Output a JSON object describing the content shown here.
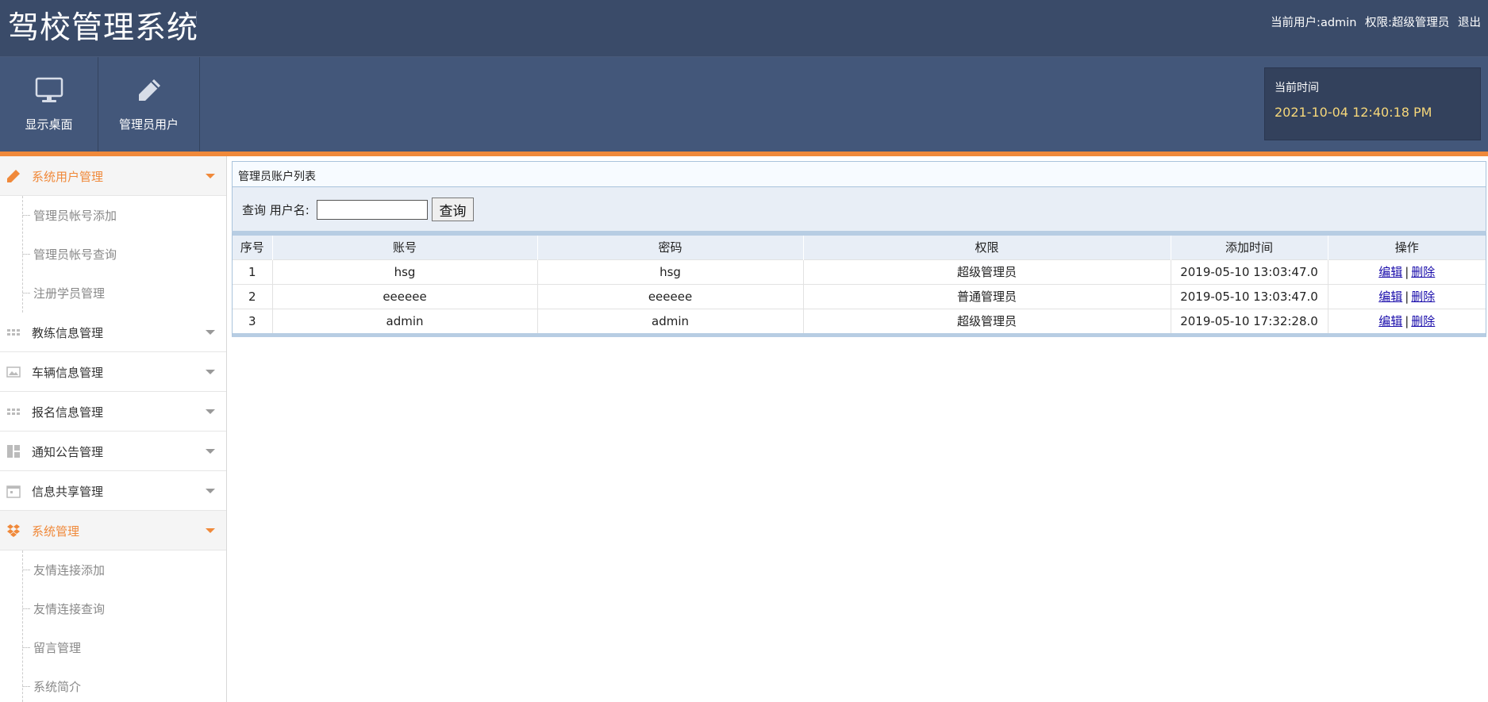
{
  "header": {
    "app_title": "驾校管理系统",
    "current_user_label": "当前用户:",
    "current_user": "admin",
    "role_label": "权限:",
    "role": "超级管理员",
    "logout": "退出"
  },
  "toolbar": {
    "items": [
      {
        "label": "显示桌面",
        "icon": "monitor-icon"
      },
      {
        "label": "管理员用户",
        "icon": "pencil-icon"
      }
    ],
    "time_label": "当前时间",
    "time_value": "2021-10-04 12:40:18 PM"
  },
  "sidebar": {
    "groups": [
      {
        "label": "系统用户管理",
        "icon": "pencil-icon",
        "active": true,
        "items": [
          "管理员帐号添加",
          "管理员帐号查询",
          "注册学员管理"
        ]
      },
      {
        "label": "教练信息管理",
        "icon": "grid-icon",
        "active": false
      },
      {
        "label": "车辆信息管理",
        "icon": "image-icon",
        "active": false
      },
      {
        "label": "报名信息管理",
        "icon": "grid-icon",
        "active": false
      },
      {
        "label": "通知公告管理",
        "icon": "layout-icon",
        "active": false
      },
      {
        "label": "信息共享管理",
        "icon": "calendar-icon",
        "active": false
      },
      {
        "label": "系统管理",
        "icon": "dropbox-icon",
        "active": true,
        "items": [
          "友情连接添加",
          "友情连接查询",
          "留言管理",
          "系统简介"
        ]
      }
    ]
  },
  "main": {
    "panel_title": "管理员账户列表",
    "search": {
      "label": "查询 用户名:",
      "value": "",
      "button": "查询"
    },
    "table": {
      "columns": [
        "序号",
        "账号",
        "密码",
        "权限",
        "添加时间",
        "操作"
      ],
      "rows": [
        {
          "index": "1",
          "account": "hsg",
          "password": "hsg",
          "role": "超级管理员",
          "added": "2019-05-10 13:03:47.0",
          "edit": "编辑",
          "delete": "删除"
        },
        {
          "index": "2",
          "account": "eeeeee",
          "password": "eeeeee",
          "role": "普通管理员",
          "added": "2019-05-10 13:03:47.0",
          "edit": "编辑",
          "delete": "删除"
        },
        {
          "index": "3",
          "account": "admin",
          "password": "admin",
          "role": "超级管理员",
          "added": "2019-05-10 17:32:28.0",
          "edit": "编辑",
          "delete": "删除"
        }
      ]
    }
  },
  "colors": {
    "header_bg": "#3a4b69",
    "toolbar_bg": "#43577a",
    "accent": "#f0893a",
    "time_color": "#f6d77a",
    "link": "#1a0dab"
  }
}
